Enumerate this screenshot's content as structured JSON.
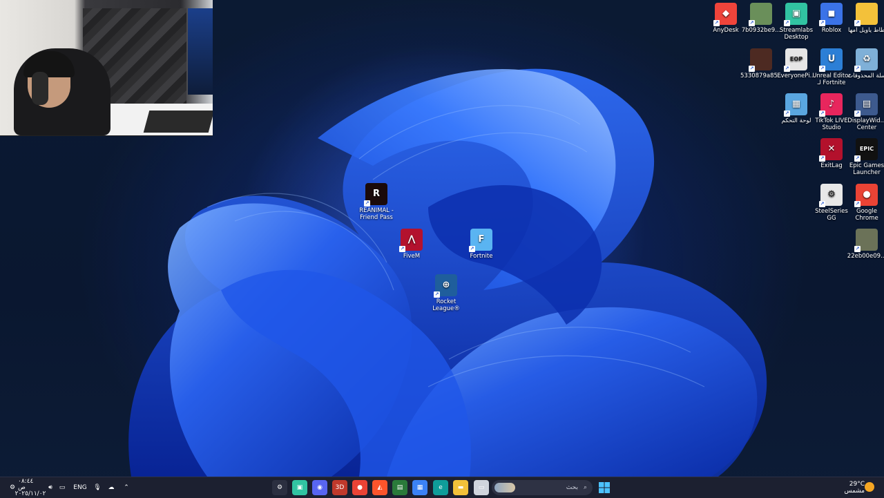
{
  "desktop_icons_right": [
    {
      "label": "AnyDesk",
      "icon": "anydesk-icon",
      "color": "#ef443b",
      "glyph": "◆"
    },
    {
      "label": "7b0932be9...",
      "icon": "image-file-icon",
      "color": "#6a8f5a",
      "glyph": ""
    },
    {
      "label": "Streamlabs Desktop",
      "icon": "streamlabs-icon",
      "color": "#31c3a2",
      "glyph": "▣"
    },
    {
      "label": "Roblox",
      "icon": "roblox-icon",
      "color": "#3b73e8",
      "glyph": "◼"
    },
    {
      "label": "طاط ياويل امها",
      "icon": "folder-icon",
      "color": "#f3c13a",
      "glyph": ""
    },
    {
      "label": "5330879a85...",
      "icon": "image-file-icon",
      "color": "#4d2a22",
      "glyph": ""
    },
    {
      "label": "EveryonePi...",
      "icon": "eop-icon",
      "color": "#e6e6e6",
      "glyph": "EOP"
    },
    {
      "label": "Unreal Editor لـ Fortnite",
      "icon": "unreal-editor-icon",
      "color": "#2c7fd6",
      "glyph": "U"
    },
    {
      "label": "سلة المحذوفات",
      "icon": "recycle-bin-icon",
      "color": "#7fb0d8",
      "glyph": "♻"
    },
    {
      "label": "لوحة التحكم",
      "icon": "control-panel-icon",
      "color": "#5aa6e0",
      "glyph": "▦"
    },
    {
      "label": "TikTok LIVE Studio",
      "icon": "tiktok-live-icon",
      "color": "#e8265d",
      "glyph": "♪"
    },
    {
      "label": "DisplayWid... Center",
      "icon": "displaywidget-icon",
      "color": "#3d5a8e",
      "glyph": "▤"
    },
    {
      "label": "ExitLag",
      "icon": "exitlag-icon",
      "color": "#b3112c",
      "glyph": "✕"
    },
    {
      "label": "Epic Games Launcher",
      "icon": "epic-games-icon",
      "color": "#111111",
      "glyph": "EPIC"
    },
    {
      "label": "SteelSeries GG",
      "icon": "steelseries-icon",
      "color": "#e8e8e8",
      "glyph": "⚙"
    },
    {
      "label": "Google Chrome",
      "icon": "chrome-icon",
      "color": "#ea4335",
      "glyph": "●"
    },
    {
      "label": "22eb00e09...",
      "icon": "image-file-icon",
      "color": "#6b7258",
      "glyph": ""
    }
  ],
  "desktop_icons_center": [
    {
      "label": "REANIMAL - Friend Pass",
      "icon": "reanimal-icon",
      "color": "#1a0a0a",
      "glyph": "R"
    },
    {
      "label": "FiveM",
      "icon": "fivem-icon",
      "color": "#b3122e",
      "glyph": "⋀"
    },
    {
      "label": "Fortnite",
      "icon": "fortnite-icon",
      "color": "#5ab4f2",
      "glyph": "F"
    },
    {
      "label": "Rocket League®",
      "icon": "rocket-league-icon",
      "color": "#1f5e9c",
      "glyph": "⊕"
    }
  ],
  "taskbar": {
    "clock_time": "٠٨:٤٤ ص",
    "clock_date": "٢٠٢٥/١١/٠٢",
    "language": "ENG",
    "search_placeholder": "بحث",
    "weather_temp": "29°C",
    "weather_text": "مشمس",
    "pinned_apps": [
      "settings-gear-icon",
      "streamlabs-icon",
      "discord-icon",
      "3d-app-icon",
      "chrome-icon",
      "brave-icon",
      "nvidia-icon",
      "store-icon",
      "edge-icon",
      "file-explorer-icon",
      "notepad-icon"
    ]
  },
  "colors": {
    "taskbar_bg": "#1c2030",
    "accent": "#3b82f6"
  }
}
